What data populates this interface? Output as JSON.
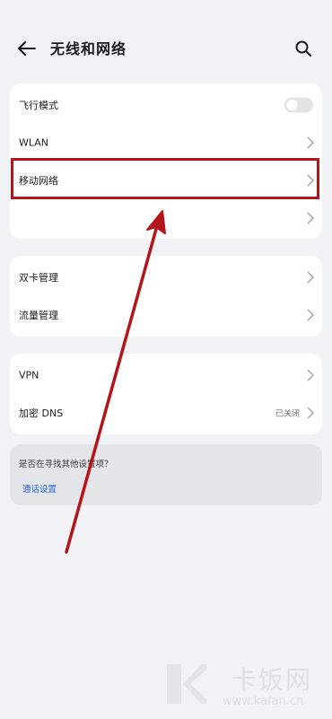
{
  "header": {
    "title": "无线和网络",
    "back_icon": "back-arrow-icon",
    "search_icon": "search-icon"
  },
  "group1": {
    "items": [
      {
        "label": "飞行模式",
        "control": "toggle",
        "toggle_on": false
      },
      {
        "label": "WLAN",
        "control": "chevron"
      },
      {
        "label": "移动网络",
        "control": "chevron"
      },
      {
        "label": "",
        "control": "chevron"
      }
    ]
  },
  "group2": {
    "items": [
      {
        "label": "双卡管理",
        "control": "chevron"
      },
      {
        "label": "流量管理",
        "control": "chevron"
      }
    ]
  },
  "group3": {
    "items": [
      {
        "label": "VPN",
        "control": "chevron"
      },
      {
        "label": "加密 DNS",
        "value": "已关闭",
        "control": "chevron"
      }
    ]
  },
  "hint": {
    "question": "是否在寻找其他设置项？",
    "link": "通话设置"
  },
  "watermark": {
    "text": "卡饭网",
    "url": "www.kafan.cn"
  },
  "colors": {
    "background": "#f1f2f5",
    "card": "#ffffff",
    "hint_card": "#e4e5e9",
    "link": "#2a64d8",
    "annotation_red": "#b3151b"
  }
}
